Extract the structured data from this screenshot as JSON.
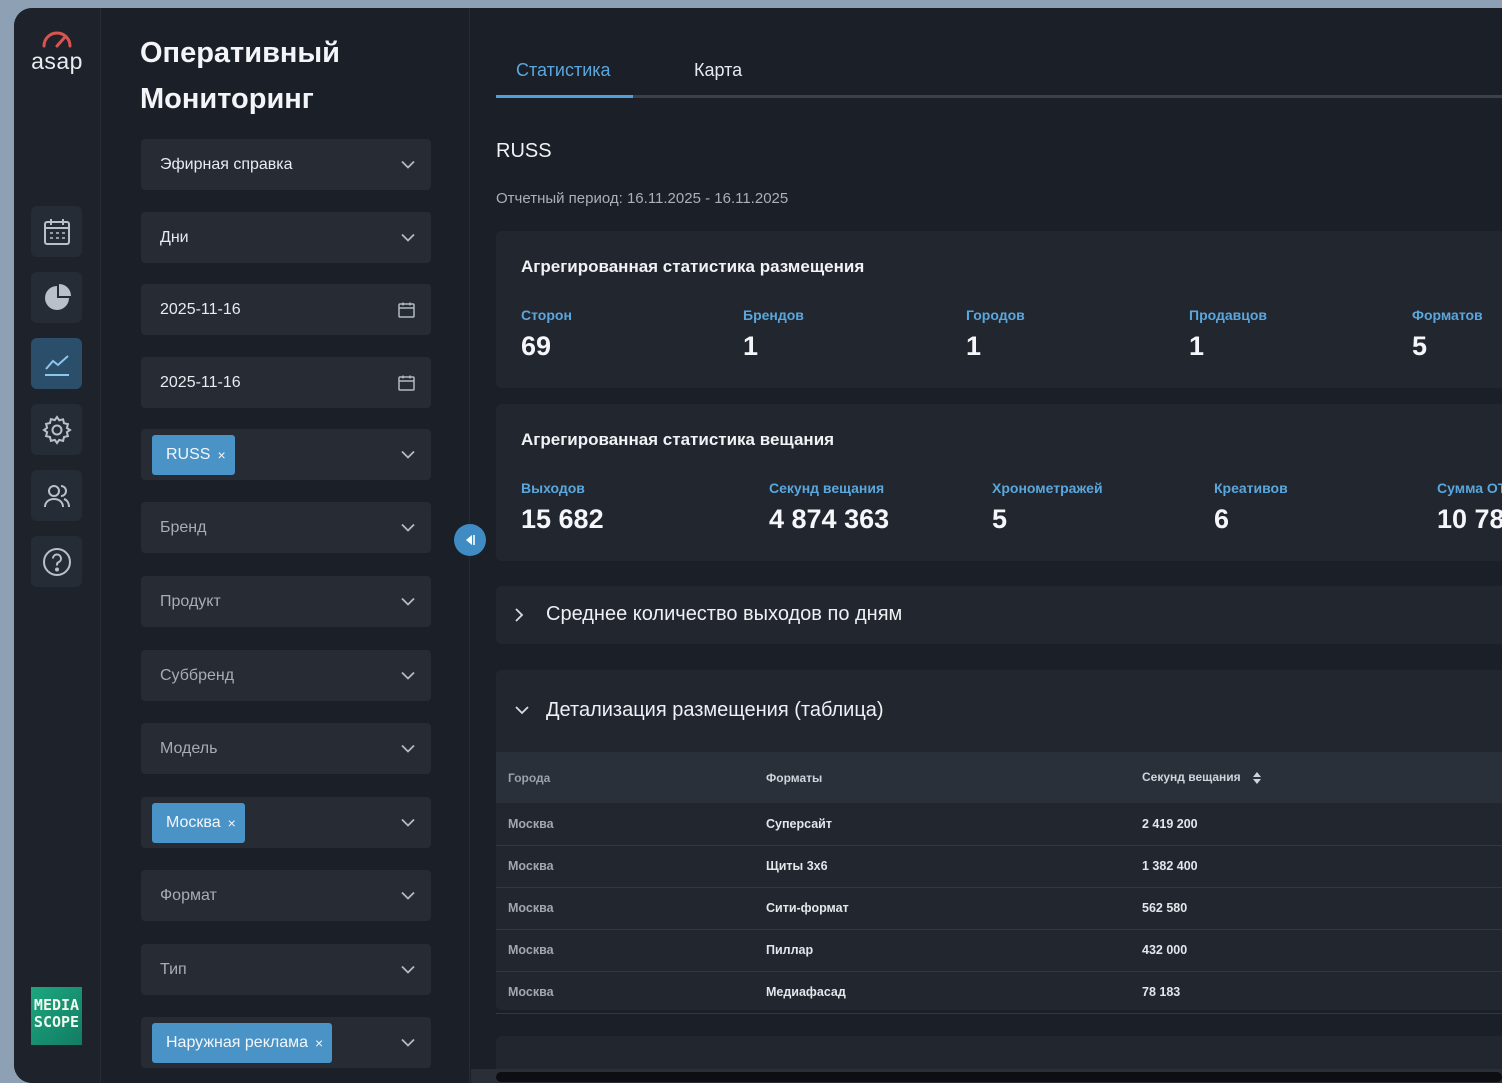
{
  "app": {
    "logo_text": "asap",
    "title": "Оперативный Мониторинг",
    "media_logo": [
      "MEDIA",
      "SCOPE"
    ]
  },
  "rail": {
    "icons": [
      "calendar-icon",
      "pie-chart-icon",
      "line-chart-icon",
      "gear-icon",
      "users-icon",
      "help-icon"
    ],
    "active": "line-chart-icon"
  },
  "filters": {
    "report_type": "Эфирная справка",
    "granularity": "Дни",
    "date_from": "2025-11-16",
    "date_to": "2025-11-16",
    "client_tag": "RUSS",
    "brand_placeholder": "Бренд",
    "product_placeholder": "Продукт",
    "subbrand_placeholder": "Суббренд",
    "model_placeholder": "Модель",
    "city_tag": "Москва",
    "format_placeholder": "Формат",
    "type_placeholder": "Тип",
    "media_tag": "Наружная реклама",
    "remove_symbol": "×"
  },
  "tabs": [
    "Статистика",
    "Карта"
  ],
  "active_tab": "Статистика",
  "report": {
    "client": "RUSS",
    "period": "Отчетный период: 16.11.2025 - 16.11.2025"
  },
  "placement_stats": {
    "title": "Агрегированная статистика размещения",
    "items": [
      {
        "label": "Сторон",
        "value": "69"
      },
      {
        "label": "Брендов",
        "value": "1"
      },
      {
        "label": "Городов",
        "value": "1"
      },
      {
        "label": "Продавцов",
        "value": "1"
      },
      {
        "label": "Форматов",
        "value": "5"
      }
    ]
  },
  "broadcast_stats": {
    "title": "Агрегированная статистика вещания",
    "items": [
      {
        "label": "Выходов",
        "value": "15 682"
      },
      {
        "label": "Секунд вещания",
        "value": "4 874 363"
      },
      {
        "label": "Хронометражей",
        "value": "5"
      },
      {
        "label": "Креативов",
        "value": "6"
      },
      {
        "label": "Сумма OT",
        "value": "10 78"
      }
    ]
  },
  "avg_section": {
    "title": "Среднее количество выходов по дням"
  },
  "detail_section": {
    "title": "Детализация размещения (таблица)",
    "columns": [
      "Города",
      "Форматы",
      "Секунд вещания"
    ],
    "rows": [
      {
        "city": "Москва",
        "format": "Суперсайт",
        "seconds": "2 419 200"
      },
      {
        "city": "Москва",
        "format": "Щиты 3х6",
        "seconds": "1 382 400"
      },
      {
        "city": "Москва",
        "format": "Сити-формат",
        "seconds": "562 580"
      },
      {
        "city": "Москва",
        "format": "Пиллар",
        "seconds": "432 000"
      },
      {
        "city": "Москва",
        "format": "Медиафасад",
        "seconds": "78 183"
      }
    ]
  }
}
